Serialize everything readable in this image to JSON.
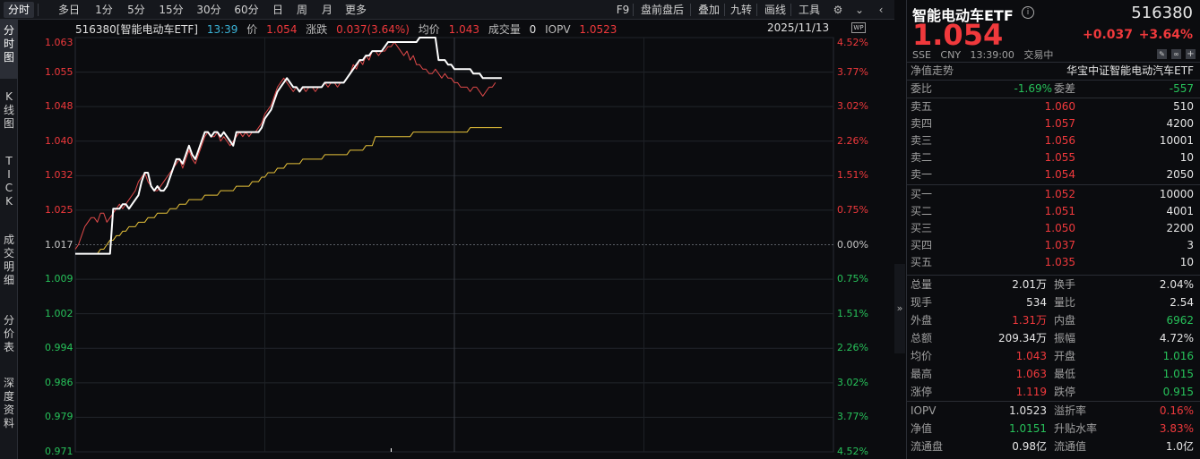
{
  "toolbar": {
    "items": [
      "分时",
      "多日",
      "1分",
      "5分",
      "15分",
      "30分",
      "60分",
      "日",
      "周",
      "月",
      "更多"
    ],
    "right_items": [
      "F9",
      "盘前盘后",
      "叠加",
      "九转",
      "画线",
      "工具"
    ],
    "settings_icon": "gear-icon",
    "chevron_icon": "chevron-down-icon",
    "collapse_icon": "chevron-left-icon"
  },
  "left_tabs": [
    "分\n时\n图",
    "K\n线\n图",
    "T\nI\nC\nK",
    "成\n交\n明\n细",
    "分\n价\n表",
    "深\n度\n资\n料"
  ],
  "chart_info": {
    "code_name": "516380[智能电动车ETF]",
    "time": "13:39",
    "price_label": "价",
    "price": "1.054",
    "change_label": "涨跌",
    "change": "0.037(3.64%)",
    "avg_label": "均价",
    "avg": "1.043",
    "volume_label": "成交量",
    "volume": "0",
    "iopv_label": "IOPV",
    "iopv": "1.0523",
    "date": "2025/11/13",
    "badge": "WP"
  },
  "chart_data": {
    "type": "line",
    "title": "",
    "xlabel": "",
    "ylabel": "",
    "prev_close": 1.017,
    "ylim": [
      0.971,
      1.063
    ],
    "y_ticks_left": [
      "1.063",
      "1.055",
      "1.048",
      "1.040",
      "1.032",
      "1.025",
      "1.017",
      "1.009",
      "1.002",
      "0.994",
      "0.986",
      "0.979",
      "0.971"
    ],
    "y_ticks_right": [
      "4.52%",
      "3.77%",
      "3.02%",
      "2.26%",
      "1.51%",
      "0.75%",
      "0.00%",
      "0.75%",
      "1.51%",
      "2.26%",
      "3.02%",
      "3.77%",
      "4.52%"
    ],
    "total_minutes": 240,
    "series": [
      {
        "name": "价",
        "color": "#ffffff",
        "values": [
          1.015,
          1.015,
          1.015,
          1.015,
          1.015,
          1.015,
          1.015,
          1.015,
          1.015,
          1.015,
          1.015,
          1.015,
          1.025,
          1.025,
          1.025,
          1.026,
          1.026,
          1.025,
          1.026,
          1.027,
          1.028,
          1.031,
          1.033,
          1.033,
          1.03,
          1.029,
          1.03,
          1.029,
          1.029,
          1.03,
          1.032,
          1.034,
          1.036,
          1.036,
          1.035,
          1.037,
          1.039,
          1.037,
          1.036,
          1.038,
          1.04,
          1.042,
          1.042,
          1.041,
          1.042,
          1.042,
          1.041,
          1.042,
          1.041,
          1.04,
          1.039,
          1.042,
          1.042,
          1.042,
          1.042,
          1.042,
          1.042,
          1.042,
          1.042,
          1.043,
          1.045,
          1.046,
          1.047,
          1.049,
          1.051,
          1.052,
          1.053,
          1.054,
          1.053,
          1.052,
          1.052,
          1.051,
          1.052,
          1.052,
          1.052,
          1.052,
          1.052,
          1.052,
          1.052,
          1.053,
          1.053,
          1.053,
          1.053,
          1.053,
          1.053,
          1.053,
          1.054,
          1.055,
          1.056,
          1.057,
          1.058,
          1.058,
          1.059,
          1.059,
          1.06,
          1.06,
          1.06,
          1.06,
          1.061,
          1.062,
          1.062,
          1.062,
          1.062,
          1.062,
          1.062,
          1.062,
          1.062,
          1.062,
          1.062,
          1.063,
          1.063,
          1.063,
          1.063,
          1.063,
          1.063,
          1.058,
          1.058,
          1.058,
          1.057,
          1.057,
          1.056,
          1.056,
          1.056,
          1.056,
          1.056,
          1.056,
          1.055,
          1.055,
          1.055,
          1.054,
          1.054,
          1.054,
          1.054,
          1.054,
          1.054,
          1.054
        ]
      },
      {
        "name": "价-red",
        "color": "#e24a4a",
        "values": [
          1.016,
          1.017,
          1.019,
          1.021,
          1.022,
          1.023,
          1.023,
          1.022,
          1.024,
          1.024,
          1.022,
          1.023,
          1.024,
          1.025,
          1.026,
          1.025,
          1.026,
          1.027,
          1.028,
          1.029,
          1.031,
          1.032,
          1.033,
          1.031,
          1.03,
          1.029,
          1.029,
          1.03,
          1.031,
          1.032,
          1.033,
          1.034,
          1.035,
          1.036,
          1.034,
          1.036,
          1.038,
          1.036,
          1.035,
          1.037,
          1.039,
          1.041,
          1.042,
          1.041,
          1.041,
          1.042,
          1.04,
          1.041,
          1.04,
          1.039,
          1.04,
          1.041,
          1.042,
          1.041,
          1.042,
          1.041,
          1.042,
          1.042,
          1.043,
          1.044,
          1.046,
          1.047,
          1.048,
          1.05,
          1.052,
          1.053,
          1.054,
          1.053,
          1.052,
          1.051,
          1.052,
          1.051,
          1.052,
          1.051,
          1.052,
          1.052,
          1.051,
          1.052,
          1.052,
          1.053,
          1.052,
          1.053,
          1.053,
          1.052,
          1.053,
          1.053,
          1.054,
          1.055,
          1.057,
          1.056,
          1.058,
          1.057,
          1.059,
          1.058,
          1.06,
          1.06,
          1.059,
          1.06,
          1.06,
          1.061,
          1.061,
          1.062,
          1.061,
          1.06,
          1.059,
          1.06,
          1.058,
          1.059,
          1.057,
          1.057,
          1.056,
          1.056,
          1.055,
          1.055,
          1.056,
          1.055,
          1.054,
          1.055,
          1.054,
          1.054,
          1.053,
          1.053,
          1.052,
          1.052,
          1.052,
          1.051,
          1.052,
          1.052,
          1.051,
          1.05,
          1.051,
          1.052,
          1.052,
          1.053
        ]
      },
      {
        "name": "均价",
        "color": "#e8c33a",
        "values": [
          1.015,
          1.015,
          1.015,
          1.015,
          1.015,
          1.015,
          1.015,
          1.015,
          1.016,
          1.016,
          1.017,
          1.018,
          1.018,
          1.019,
          1.019,
          1.02,
          1.02,
          1.021,
          1.021,
          1.021,
          1.022,
          1.022,
          1.022,
          1.023,
          1.023,
          1.023,
          1.024,
          1.024,
          1.024,
          1.024,
          1.025,
          1.025,
          1.025,
          1.026,
          1.026,
          1.026,
          1.027,
          1.027,
          1.027,
          1.027,
          1.027,
          1.028,
          1.028,
          1.028,
          1.028,
          1.028,
          1.029,
          1.029,
          1.029,
          1.029,
          1.029,
          1.03,
          1.03,
          1.03,
          1.03,
          1.03,
          1.031,
          1.031,
          1.031,
          1.032,
          1.032,
          1.033,
          1.033,
          1.033,
          1.034,
          1.034,
          1.034,
          1.035,
          1.035,
          1.035,
          1.035,
          1.035,
          1.036,
          1.036,
          1.036,
          1.036,
          1.036,
          1.036,
          1.036,
          1.037,
          1.037,
          1.037,
          1.037,
          1.037,
          1.037,
          1.037,
          1.037,
          1.038,
          1.038,
          1.038,
          1.038,
          1.038,
          1.039,
          1.039,
          1.039,
          1.041,
          1.041,
          1.041,
          1.041,
          1.041,
          1.041,
          1.041,
          1.041,
          1.041,
          1.041,
          1.041,
          1.041,
          1.042,
          1.042,
          1.042,
          1.042,
          1.042,
          1.042,
          1.042,
          1.042,
          1.042,
          1.042,
          1.042,
          1.042,
          1.042,
          1.042,
          1.042,
          1.042,
          1.042,
          1.042,
          1.043,
          1.043,
          1.043,
          1.043,
          1.043,
          1.043,
          1.043,
          1.043,
          1.043,
          1.043,
          1.043
        ]
      }
    ],
    "grid": true
  },
  "panel": {
    "name": "智能电动车ETF",
    "code": "516380",
    "price": "1.054",
    "change": "+0.037",
    "change_pct": "+3.64%",
    "meta": "SSE   CNY   13:39:00   交易中",
    "nav_trend": "净值走势",
    "index_name": "华宝中证智能电动汽车ETF",
    "weibi_label": "委比",
    "weibi": "-1.69%",
    "weicha_label": "委差",
    "weicha": "-557",
    "asks": [
      {
        "label": "卖五",
        "price": "1.060",
        "vol": "510"
      },
      {
        "label": "卖四",
        "price": "1.057",
        "vol": "4200"
      },
      {
        "label": "卖三",
        "price": "1.056",
        "vol": "10001"
      },
      {
        "label": "卖二",
        "price": "1.055",
        "vol": "10"
      },
      {
        "label": "卖一",
        "price": "1.054",
        "vol": "2050"
      }
    ],
    "bids": [
      {
        "label": "买一",
        "price": "1.052",
        "vol": "10000"
      },
      {
        "label": "买二",
        "price": "1.051",
        "vol": "4001"
      },
      {
        "label": "买三",
        "price": "1.050",
        "vol": "2200"
      },
      {
        "label": "买四",
        "price": "1.037",
        "vol": "3"
      },
      {
        "label": "买五",
        "price": "1.035",
        "vol": "10"
      }
    ],
    "stats": [
      {
        "l1": "总量",
        "v1": "2.01万",
        "c1": "white",
        "l2": "换手",
        "v2": "2.04%",
        "c2": "white"
      },
      {
        "l1": "现手",
        "v1": "534",
        "c1": "white",
        "l2": "量比",
        "v2": "2.54",
        "c2": "white"
      },
      {
        "l1": "外盘",
        "v1": "1.31万",
        "c1": "red",
        "l2": "内盘",
        "v2": "6962",
        "c2": "green"
      },
      {
        "l1": "总额",
        "v1": "209.34万",
        "c1": "white",
        "l2": "振幅",
        "v2": "4.72%",
        "c2": "white"
      },
      {
        "l1": "均价",
        "v1": "1.043",
        "c1": "red",
        "l2": "开盘",
        "v2": "1.016",
        "c2": "green"
      },
      {
        "l1": "最高",
        "v1": "1.063",
        "c1": "red",
        "l2": "最低",
        "v2": "1.015",
        "c2": "green"
      },
      {
        "l1": "涨停",
        "v1": "1.119",
        "c1": "red",
        "l2": "跌停",
        "v2": "0.915",
        "c2": "green"
      }
    ],
    "stats2": [
      {
        "l1": "IOPV",
        "v1": "1.0523",
        "c1": "white",
        "l2": "溢折率",
        "v2": "0.16%",
        "c2": "red"
      },
      {
        "l1": "净值",
        "v1": "1.0151",
        "c1": "green",
        "l2": "升贴水率",
        "v2": "3.83%",
        "c2": "red"
      },
      {
        "l1": "流通盘",
        "v1": "0.98亿",
        "c1": "white",
        "l2": "流通值",
        "v2": "1.0亿",
        "c2": "white"
      }
    ],
    "colors": {
      "up": "#f0393c",
      "down": "#27c25a"
    }
  }
}
